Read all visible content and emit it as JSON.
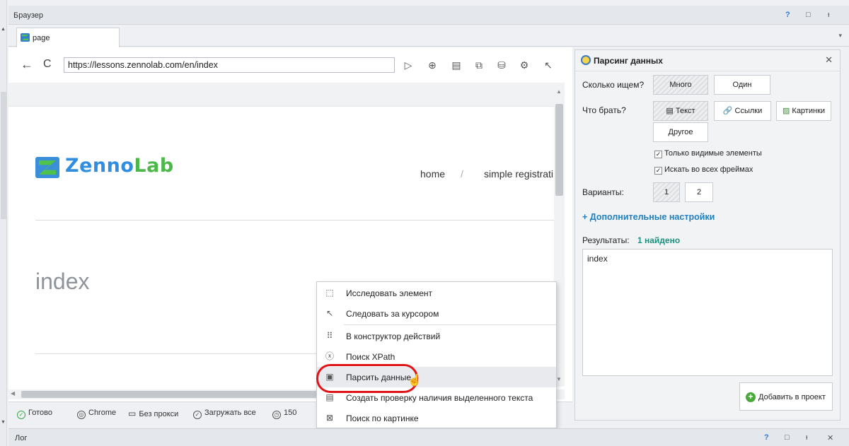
{
  "window": {
    "title": "Браузер",
    "help": "?",
    "restore": "□",
    "pin": "ᵻ"
  },
  "tab": {
    "label": "page",
    "menu": "▾"
  },
  "navbar": {
    "back": "←",
    "reload": "C",
    "url": "https://lessons.zennolab.com/en/index",
    "toolbar_icons": [
      "play-icon",
      "add-circle-icon",
      "document-icon",
      "puzzle-icon",
      "database-icon",
      "settings-icon",
      "cursor-icon"
    ]
  },
  "page": {
    "logo_text_1": "Zenno",
    "logo_text_2": "Lab",
    "nav_home": "home",
    "nav_sep": "/",
    "nav_simple": "simple registrati",
    "title": "index"
  },
  "statusbar": {
    "ready": "Готово",
    "browser": "Chrome",
    "proxy": "Без прокси",
    "load": "Загружать все",
    "timeout": "150"
  },
  "context_menu": {
    "items": [
      {
        "label": "Исследовать элемент",
        "icon": "inspect-icon"
      },
      {
        "label": "Следовать за курсором",
        "icon": "follow-cursor-icon"
      },
      {
        "label": "В конструктор действий",
        "icon": "grid-icon"
      },
      {
        "label": "Поиск XPath",
        "icon": "xpath-icon"
      },
      {
        "label": "Парсить данные",
        "icon": "parse-icon"
      },
      {
        "label": "Создать проверку наличия выделенного текста",
        "icon": "check-text-icon"
      },
      {
        "label": "Поиск по картинке",
        "icon": "image-search-icon"
      }
    ]
  },
  "panel": {
    "title": "Парсинг данных",
    "how_many_label": "Сколько ищем?",
    "many": "Много",
    "one": "Один",
    "what_label": "Что брать?",
    "text": "Текст",
    "links": "Ссылки",
    "images": "Картинки",
    "other": "Другое",
    "only_visible": "Только видимые элементы",
    "all_frames": "Искать во всех фреймах",
    "variants_label": "Варианты:",
    "variant_1": "1",
    "variant_2": "2",
    "more_settings": "+ Дополнительные настройки",
    "results_label": "Результаты:",
    "results_count": "1 найдено",
    "result_value": "index",
    "add_button": "Добавить в проект",
    "close": "✕"
  },
  "log": {
    "title": "Лог"
  }
}
